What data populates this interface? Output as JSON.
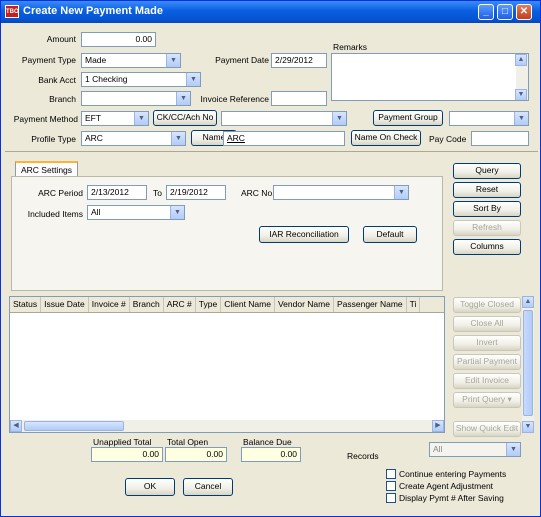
{
  "window": {
    "title": "Create New Payment Made",
    "app_badge": "TBO"
  },
  "form": {
    "amount_label": "Amount",
    "amount_value": "0.00",
    "payment_type_label": "Payment Type",
    "payment_type_value": "Made",
    "payment_date_label": "Payment Date",
    "payment_date_value": "2/29/2012",
    "remarks_label": "Remarks",
    "bank_acct_label": "Bank Acct",
    "bank_acct_value": "1 Checking",
    "branch_label": "Branch",
    "branch_value": "",
    "invoice_reference_label": "Invoice Reference",
    "invoice_reference_value": "",
    "payment_method_label": "Payment Method",
    "payment_method_value": "EFT",
    "ck_button": "CK/CC/Ach No",
    "ck_value": "",
    "payment_group_button": "Payment Group",
    "payment_group_value": "",
    "profile_type_label": "Profile Type",
    "profile_type_value": "ARC",
    "name_button": "Name",
    "name_value": "ARC",
    "name_on_check_button": "Name On Check",
    "pay_code_label": "Pay Code",
    "pay_code_value": ""
  },
  "arc_settings": {
    "tab_label": "ARC Settings",
    "arc_period_label": "ARC Period",
    "arc_period_from": "2/13/2012",
    "to_label": "To",
    "arc_period_to": "2/19/2012",
    "arc_no_label": "ARC No.",
    "arc_no_value": "",
    "included_items_label": "Included Items",
    "included_items_value": "All",
    "iar_button": "IAR Reconciliation",
    "default_button": "Default"
  },
  "side_buttons": {
    "query": "Query",
    "reset": "Reset",
    "sort_by": "Sort By",
    "refresh": "Refresh",
    "columns": "Columns"
  },
  "grid": {
    "columns": [
      "Status",
      "Issue Date",
      "Invoice #",
      "Branch",
      "ARC #",
      "Type",
      "Client Name",
      "Vendor Name",
      "Passenger Name",
      "Ti"
    ],
    "rows": []
  },
  "grid_buttons": {
    "toggle_closed": "Toggle Closed",
    "close_all": "Close All",
    "invert": "Invert",
    "partial_payment": "Partial Payment",
    "edit_invoice": "Edit Invoice",
    "print_query": "Print Query",
    "show_quick_edit": "Show Quick Edit"
  },
  "totals": {
    "unapplied_label": "Unapplied Total",
    "unapplied_value": "0.00",
    "total_open_label": "Total Open",
    "total_open_value": "0.00",
    "balance_due_label": "Balance Due",
    "balance_due_value": "0.00",
    "records_label": "Records",
    "records_value": "All"
  },
  "footer": {
    "ok_button": "OK",
    "cancel_button": "Cancel",
    "continue_label": "Continue entering Payments",
    "agent_adjust_label": "Create Agent Adjustment",
    "display_pymt_label": "Display Pymt # After Saving"
  }
}
